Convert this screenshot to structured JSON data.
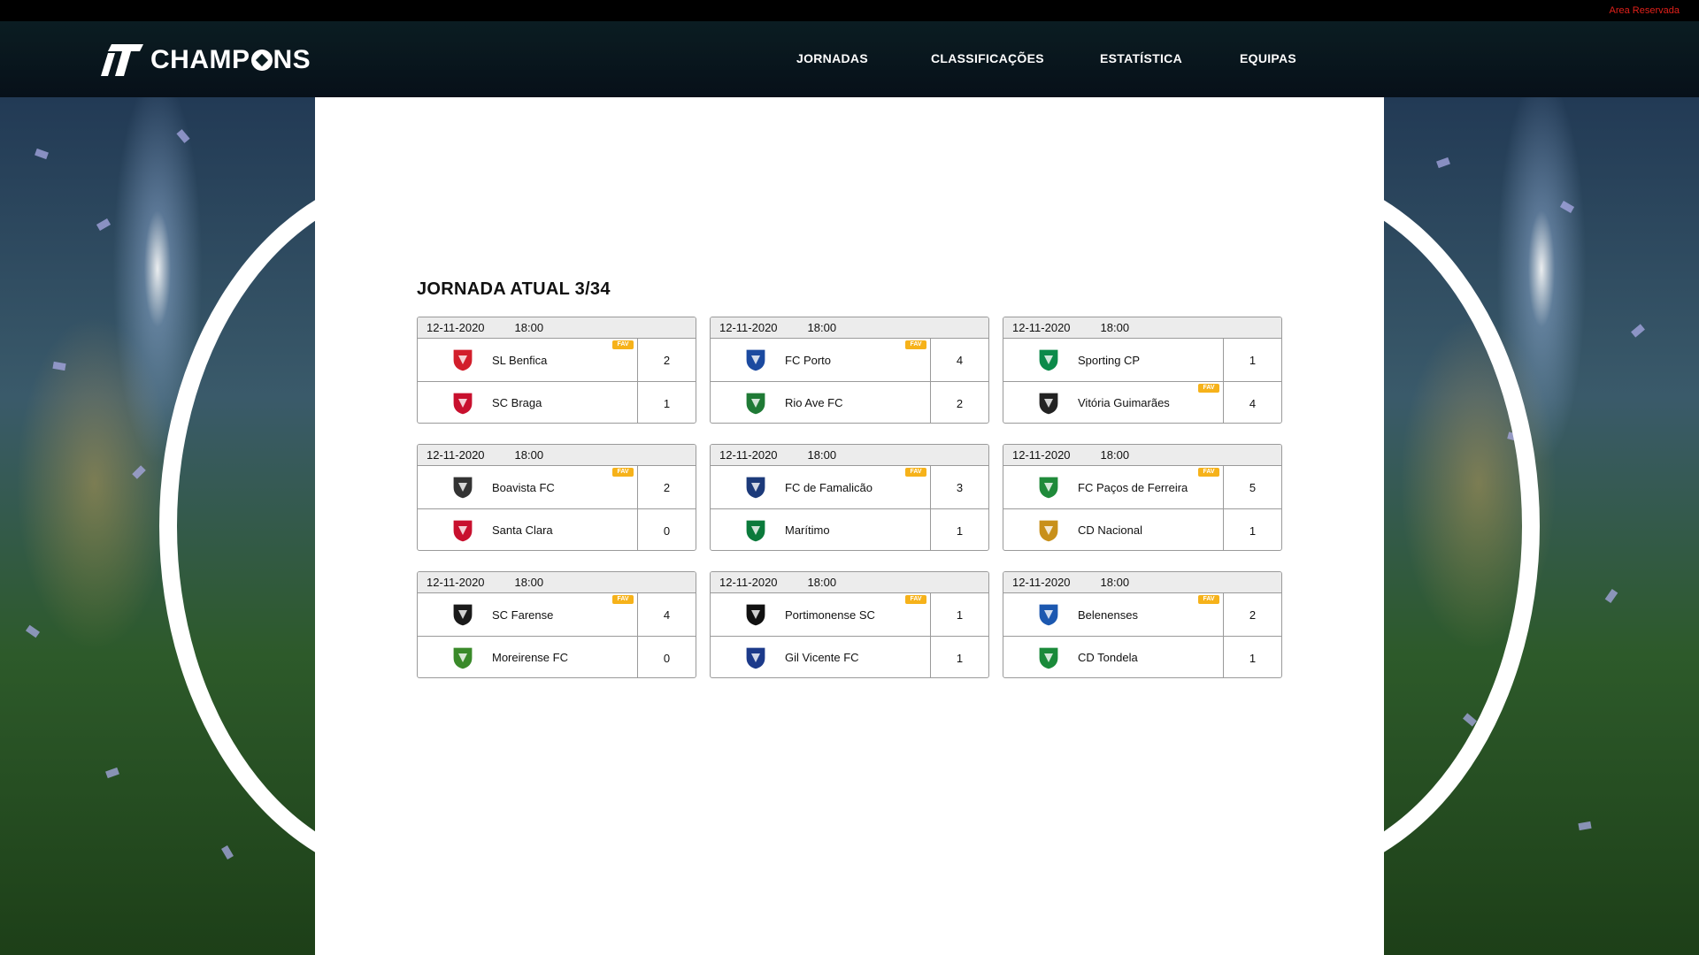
{
  "topbar": {
    "area_label": "Area Reservada"
  },
  "brand": {
    "name_pre": "CHAMP",
    "name_post": "NS"
  },
  "nav": {
    "items": [
      "JORNADAS",
      "CLASSIFICAÇÕES",
      "ESTATÍSTICA",
      "EQUIPAS"
    ]
  },
  "colors": {
    "fav_badge": "#f6b21a",
    "area_link": "#e0201a",
    "header_bg": "#071019"
  },
  "jornada": {
    "title": "JORNADA ATUAL 3/34"
  },
  "matches": [
    {
      "date": "12-11-2020",
      "time": "18:00",
      "fav_label": "FAV",
      "home": {
        "name": "SL Benfica",
        "score": "2",
        "crest_color": "#d21e2b"
      },
      "away": {
        "name": "SC Braga",
        "score": "1",
        "crest_color": "#c8102e"
      }
    },
    {
      "date": "12-11-2020",
      "time": "18:00",
      "fav_label": "FAV",
      "home": {
        "name": "FC Porto",
        "score": "4",
        "crest_color": "#1b4aa0"
      },
      "away": {
        "name": "Rio Ave FC",
        "score": "2",
        "crest_color": "#1f7a35"
      }
    },
    {
      "date": "12-11-2020",
      "time": "18:00",
      "fav_label": "FAV",
      "home": {
        "name": "Sporting CP",
        "score": "1",
        "crest_color": "#0b8a4a"
      },
      "away": {
        "name": "Vitória Guimarães",
        "score": "4",
        "crest_color": "#222222"
      }
    },
    {
      "date": "12-11-2020",
      "time": "18:00",
      "fav_label": "FAV",
      "home": {
        "name": "Boavista FC",
        "score": "2",
        "crest_color": "#333333"
      },
      "away": {
        "name": "Santa Clara",
        "score": "0",
        "crest_color": "#c8102e"
      }
    },
    {
      "date": "12-11-2020",
      "time": "18:00",
      "fav_label": "FAV",
      "home": {
        "name": "FC  de Famalicão",
        "score": "3",
        "crest_color": "#1c3a7a"
      },
      "away": {
        "name": "Marítimo",
        "score": "1",
        "crest_color": "#0b7a3b"
      }
    },
    {
      "date": "12-11-2020",
      "time": "18:00",
      "fav_label": "FAV",
      "home": {
        "name": "FC Paços de Ferreira",
        "score": "5",
        "crest_color": "#1f8a3a"
      },
      "away": {
        "name": "CD Nacional",
        "score": "1",
        "crest_color": "#c8901a"
      }
    },
    {
      "date": "12-11-2020",
      "time": "18:00",
      "fav_label": "FAV",
      "home": {
        "name": "SC Farense",
        "score": "4",
        "crest_color": "#1a1a1a"
      },
      "away": {
        "name": "Moreirense FC",
        "score": "0",
        "crest_color": "#3a8a2a"
      }
    },
    {
      "date": "12-11-2020",
      "time": "18:00",
      "fav_label": "FAV",
      "home": {
        "name": "Portimonense SC",
        "score": "1",
        "crest_color": "#111111"
      },
      "away": {
        "name": "Gil Vicente FC",
        "score": "1",
        "crest_color": "#1c3a8a"
      }
    },
    {
      "date": "12-11-2020",
      "time": "18:00",
      "fav_label": "FAV",
      "home": {
        "name": "Belenenses",
        "score": "2",
        "crest_color": "#1c58b0"
      },
      "away": {
        "name": "CD Tondela",
        "score": "1",
        "crest_color": "#1a8a3a"
      }
    }
  ]
}
